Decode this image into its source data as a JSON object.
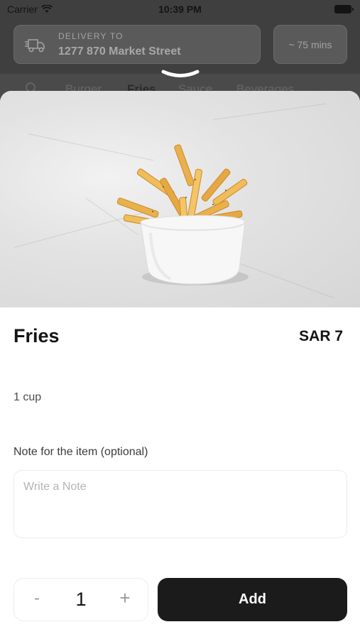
{
  "status_bar": {
    "carrier": "Carrier",
    "time": "10:39 PM"
  },
  "background_app": {
    "delivery_label": "DELIVERY TO",
    "delivery_address": "1277 870 Market Street",
    "eta": "~ 75 mins",
    "categories": [
      {
        "label": "Burger",
        "active": false
      },
      {
        "label": "Fries",
        "active": true
      },
      {
        "label": "Sauce",
        "active": false
      },
      {
        "label": "Beverages",
        "active": false
      }
    ]
  },
  "item": {
    "name": "Fries",
    "price": "SAR 7",
    "description": "1 cup",
    "image_icon": "fries-photo"
  },
  "note": {
    "label": "Note for the item (optional)",
    "placeholder": "Write a Note",
    "value": ""
  },
  "quantity": {
    "minus_label": "-",
    "value": "1",
    "plus_label": "+"
  },
  "actions": {
    "add_label": "Add"
  },
  "colors": {
    "primary_button": "#1b1b1b",
    "dim_overlay": "#3f3f3f"
  }
}
